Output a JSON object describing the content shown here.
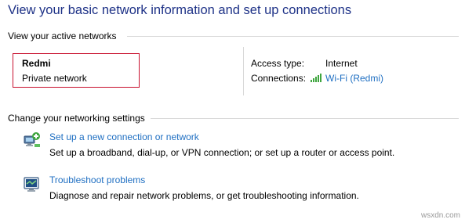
{
  "page": {
    "title": "View your basic network information and set up connections"
  },
  "active_networks": {
    "heading": "View your active networks",
    "network": {
      "name": "Redmi",
      "category": "Private network"
    },
    "access_type_label": "Access type:",
    "access_type_value": "Internet",
    "connections_label": "Connections:",
    "connections_value": "Wi-Fi (Redmi)",
    "connection_icon": "wifi-signal-icon"
  },
  "change_settings": {
    "heading": "Change your networking settings",
    "tasks": [
      {
        "icon": "new-connection-icon",
        "label": "Set up a new connection or network",
        "description": "Set up a broadband, dial-up, or VPN connection; or set up a router or access point."
      },
      {
        "icon": "troubleshoot-icon",
        "label": "Troubleshoot problems",
        "description": "Diagnose and repair network problems, or get troubleshooting information."
      }
    ]
  },
  "watermark": "wsxdn.com",
  "colors": {
    "title": "#1e3287",
    "link": "#1f6fc2",
    "highlight_box": "#c8102e",
    "divider": "#d8d8d8",
    "signal": "#3ea53e"
  }
}
